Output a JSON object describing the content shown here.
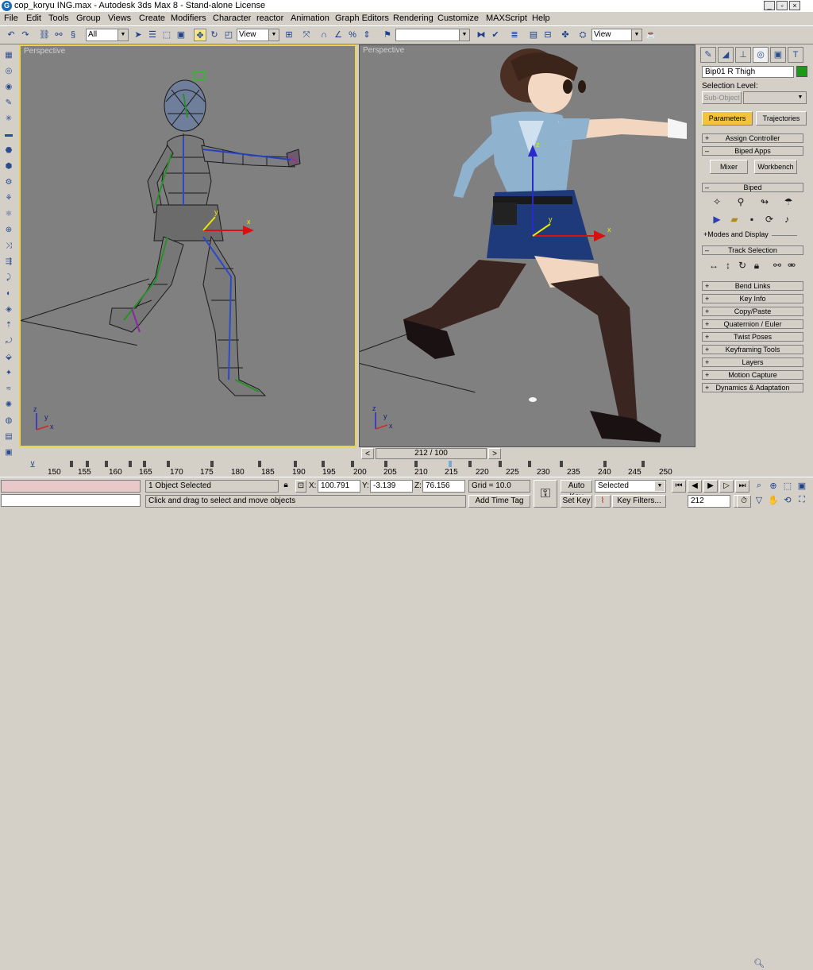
{
  "window": {
    "title": "cop_koryu ING.max - Autodesk 3ds Max 8 - Stand-alone License"
  },
  "menu": [
    "File",
    "Edit",
    "Tools",
    "Group",
    "Views",
    "Create",
    "Modifiers",
    "Character",
    "reactor",
    "Animation",
    "Graph Editors",
    "Rendering",
    "Customize",
    "MAXScript",
    "Help"
  ],
  "toolbar": {
    "selection_filter": "All",
    "ref_coord": "View",
    "named_selection": "",
    "ref_coord2": "View"
  },
  "viewports": {
    "left_label": "Perspective",
    "right_label": "Perspective"
  },
  "panel": {
    "object_name": "Bip01 R Thigh",
    "object_color": "#1a9a1a",
    "selection_level_label": "Selection Level:",
    "sub_object": "Sub-Object",
    "tab_parameters": "Parameters",
    "tab_trajectories": "Trajectories",
    "assign_controller": "Assign Controller",
    "biped_apps": "Biped Apps",
    "mixer": "Mixer",
    "workbench": "Workbench",
    "biped": "Biped",
    "modes_display": "+Modes and Display",
    "track_selection": "Track Selection",
    "rollouts": [
      "Bend Links",
      "Key Info",
      "Copy/Paste",
      "Quaternion / Euler",
      "Twist Poses",
      "Keyframing Tools",
      "Layers",
      "Motion Capture",
      "Dynamics & Adaptation"
    ]
  },
  "timeline": {
    "slider": "212 / 100",
    "labels": [
      "150",
      "155",
      "160",
      "165",
      "170",
      "175",
      "180",
      "185",
      "190",
      "195",
      "200",
      "205",
      "210",
      "215",
      "220",
      "225",
      "230",
      "235",
      "240",
      "245",
      "250"
    ]
  },
  "status": {
    "selected": "1 Object Selected",
    "prompt": "Click and drag to select and move objects",
    "x_label": "X:",
    "x": "100.791",
    "y_label": "Y:",
    "y": "-3.139",
    "z_label": "Z:",
    "z": "76.156",
    "grid": "Grid = 10.0",
    "add_time_tag": "Add Time Tag",
    "auto_key": "Auto Key",
    "set_key": "Set Key",
    "key_mode": "Selected",
    "key_filters": "Key Filters...",
    "frame": "212"
  }
}
